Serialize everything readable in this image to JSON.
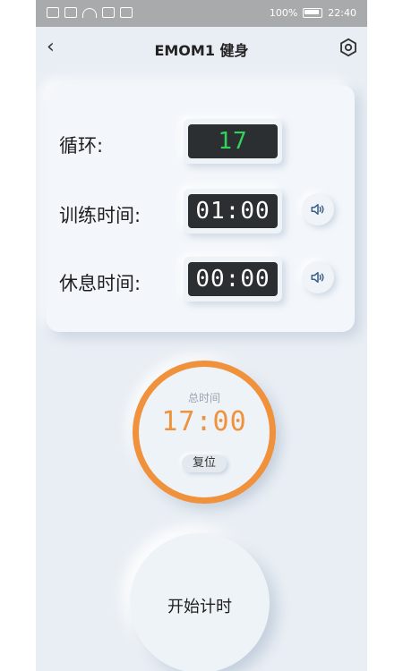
{
  "status_bar": {
    "battery_text": "100%",
    "time": "22:40"
  },
  "header": {
    "title": "EMOM1 健身",
    "back_icon": "chevron-left-icon",
    "settings_icon": "hexagon-gear-icon"
  },
  "settings_card": {
    "rounds_label": "循环:",
    "rounds_value": "17",
    "work_label": "训练时间:",
    "work_value": "01:00",
    "rest_label": "休息时间:",
    "rest_value": "00:00",
    "speaker_icon": "speaker-icon"
  },
  "total": {
    "label": "总时间",
    "value": "17:00",
    "reset_label": "复位"
  },
  "start_button": {
    "label": "开始计时"
  },
  "colors": {
    "accent": "#f0913b",
    "lcd_green": "#32d35b",
    "lcd_bg": "#2c2f31",
    "background": "#e9eef4"
  }
}
